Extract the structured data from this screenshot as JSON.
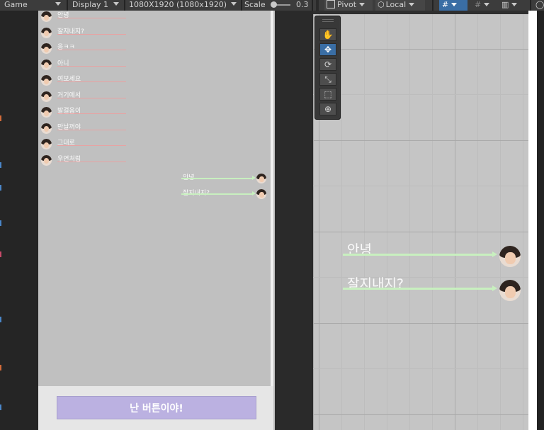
{
  "toolbar": {
    "game_tab": "Game",
    "display": "Display 1",
    "resolution": "1080X1920 (1080x1920)",
    "scale_label": "Scale",
    "scale_value": "0.3",
    "pivot": "Pivot",
    "space": "Local"
  },
  "game_view": {
    "left_messages": [
      "안녕",
      "잘지내지?",
      "응ㅋㅋ",
      "아니",
      "여보세요",
      "거기에서",
      "발걸음이",
      "만날꺼야",
      "그대로",
      "우연처럼"
    ],
    "right_messages": [
      "안녕",
      "잘지내지?"
    ],
    "button_label": "난 버튼이야!"
  },
  "scene_view": {
    "messages": [
      "안녕",
      "잘지내지?"
    ]
  },
  "icons": {
    "tools": [
      "hand-tool-icon",
      "move-tool-icon",
      "rotate-tool-icon",
      "scale-tool-icon",
      "rect-tool-icon",
      "transform-tool-icon"
    ]
  },
  "colors": {
    "left_underline": "#e8a2a2",
    "right_line": "#c8f0bf",
    "button": "#bbb1e1",
    "canvas": "#c0c0c0",
    "active_tool": "#3a6ea5"
  }
}
